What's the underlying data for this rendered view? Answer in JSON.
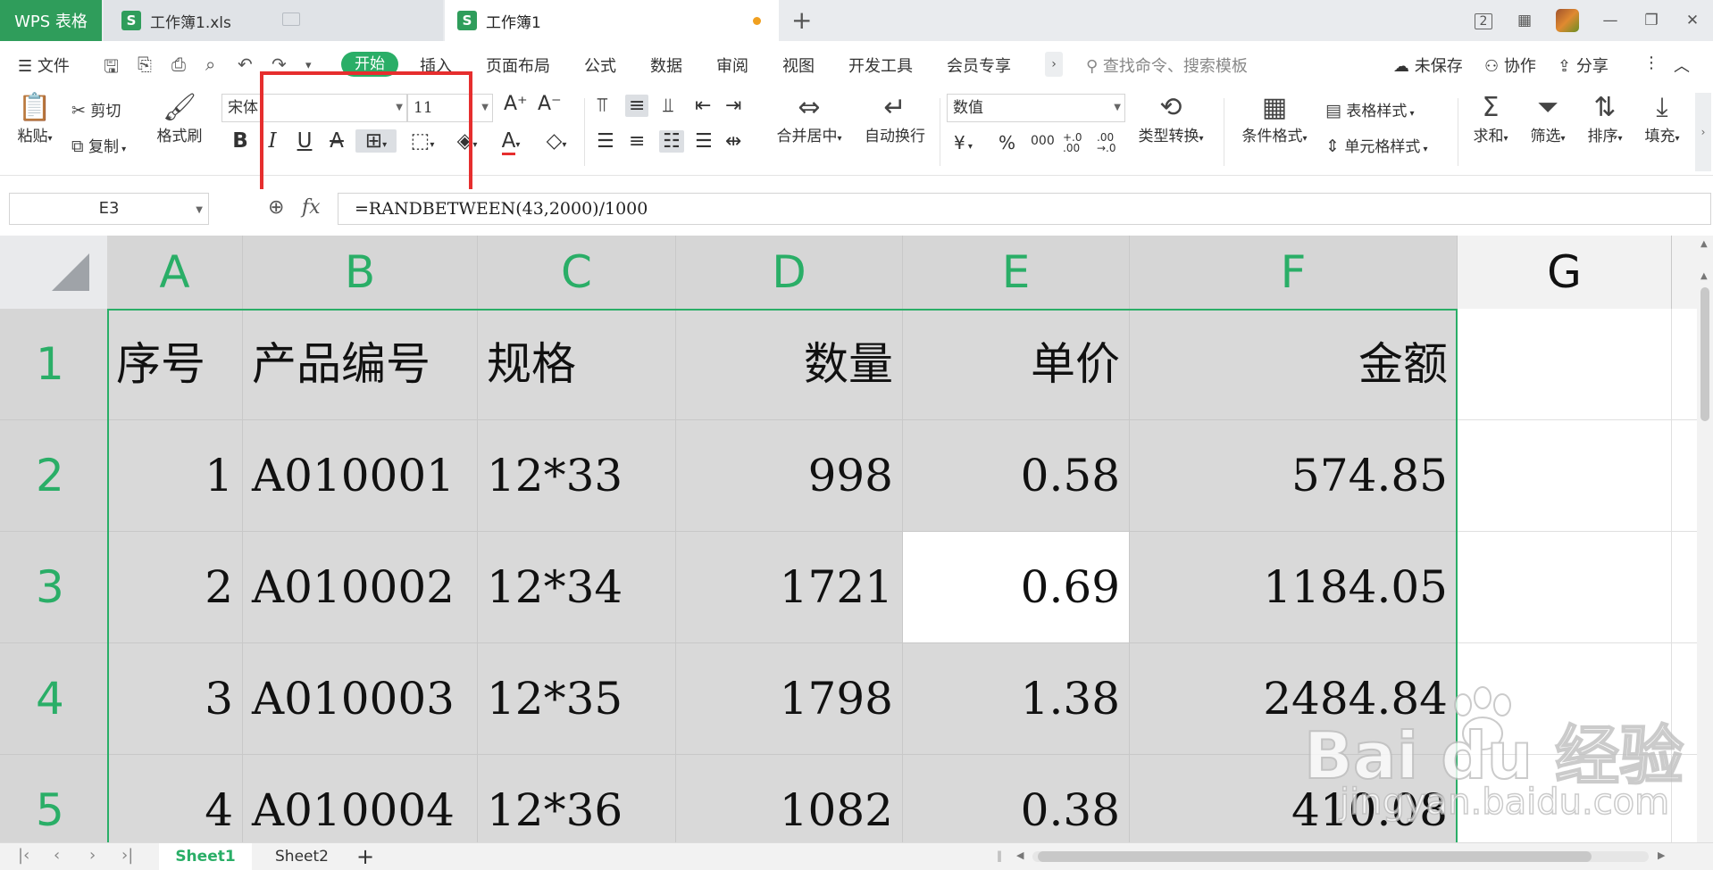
{
  "titlebar": {
    "app_tab": "WPS 表格",
    "tabs": [
      {
        "label": "工作簿1.xls",
        "icon": "S"
      },
      {
        "label": "工作簿1",
        "icon": "S"
      }
    ],
    "new_tab": "+",
    "page_badge": "2"
  },
  "menubar": {
    "file": "文件",
    "items": [
      "开始",
      "插入",
      "页面布局",
      "公式",
      "数据",
      "审阅",
      "视图",
      "开发工具",
      "会员专享"
    ],
    "more": "›",
    "search_placeholder": "查找命令、搜索模板",
    "right": [
      "未保存",
      "协作",
      "分享"
    ]
  },
  "ribbon": {
    "paste": "粘贴",
    "cut": "剪切",
    "copy": "复制",
    "format_painter": "格式刷",
    "font_name": "宋体",
    "font_size": "11",
    "bold": "B",
    "italic": "I",
    "underline": "U",
    "strike": "A",
    "font_color": "A",
    "merge": "合并居中",
    "wrap": "自动换行",
    "number_format": "数值",
    "currency": "¥",
    "percent": "%",
    "thousands": "000",
    "inc_decimal": "+.0 .00",
    "dec_decimal": ".00 →.0",
    "type_convert": "类型转换",
    "cond_format": "条件格式",
    "table_style": "表格样式",
    "cell_style": "单元格样式",
    "sum": "求和",
    "filter": "筛选",
    "sort": "排序",
    "fill": "填充"
  },
  "formula_bar": {
    "cell_ref": "E3",
    "fx": "fx",
    "formula": "=RANDBETWEEN(43,2000)/1000"
  },
  "sheet": {
    "columns": [
      "A",
      "B",
      "C",
      "D",
      "E",
      "F",
      "G"
    ],
    "rows": [
      "1",
      "2",
      "3",
      "4",
      "5"
    ],
    "cells": [
      [
        "序号",
        "产品编号",
        "规格",
        "数量",
        "单价",
        "金额"
      ],
      [
        "1",
        "A010001",
        "12*33",
        "998",
        "0.58",
        "574.85"
      ],
      [
        "2",
        "A010002",
        "12*34",
        "1721",
        "0.69",
        "1184.05"
      ],
      [
        "3",
        "A010003",
        "12*35",
        "1798",
        "1.38",
        "2484.84"
      ],
      [
        "4",
        "A010004",
        "12*36",
        "1082",
        "0.38",
        "410.08"
      ]
    ],
    "active_cell": "E3"
  },
  "sheet_tabs": {
    "tabs": [
      "Sheet1",
      "Sheet2"
    ],
    "active": "Sheet1",
    "add": "+"
  },
  "watermark": {
    "brand": "Bai du 经验",
    "url": "jingyan.baidu.com"
  },
  "colors": {
    "accent": "#2aae67",
    "app_tab": "#2f9d5b",
    "highlight_box": "#e62e2e",
    "cell_fill": "#d9d9d9"
  }
}
